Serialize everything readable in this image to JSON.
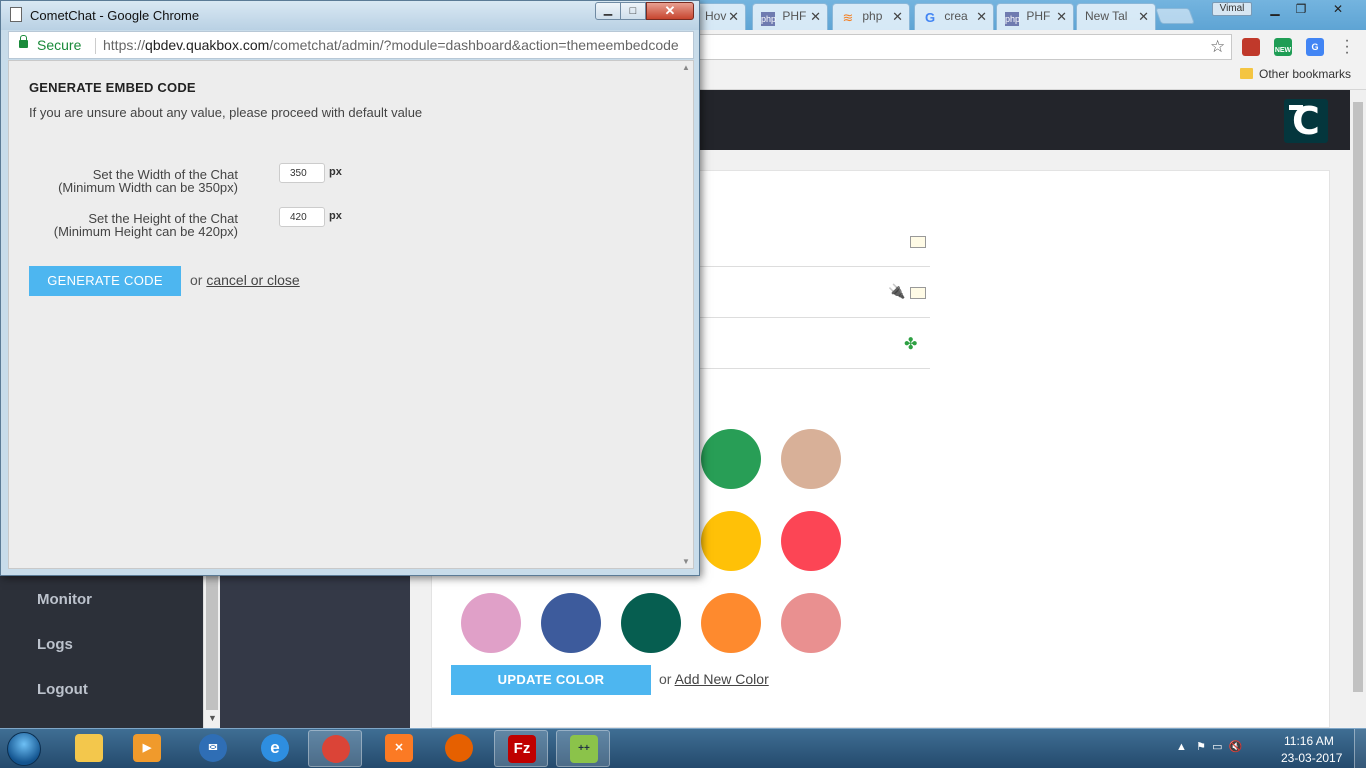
{
  "background_window": {
    "tabs": [
      {
        "label": "Hov",
        "favicon": "doc-icon"
      },
      {
        "label": "PHF",
        "favicon": "php-icon"
      },
      {
        "label": "php",
        "favicon": "stackoverflow-icon"
      },
      {
        "label": "crea",
        "favicon": "google-icon"
      },
      {
        "label": "PHF",
        "favicon": "php-icon"
      },
      {
        "label": "New Tal",
        "favicon": ""
      }
    ],
    "tab_close_glyph": "✕",
    "user_badge": "Vimal",
    "other_bookmarks": "Other bookmarks",
    "ext_new_badge": "NEW",
    "logo_letter": "C",
    "sidebar": [
      {
        "label": "Monitor"
      },
      {
        "label": "Logs"
      },
      {
        "label": "Logout"
      }
    ],
    "color_swatches": [
      "#289e56",
      "#d8b098",
      "#ffc107",
      "#fc4555",
      "#e0a0c8",
      "#3d5b9c",
      "#065e50",
      "#fe8a2e",
      "#e99090"
    ],
    "update_color_label": "UPDATE COLOR",
    "or_text": "or",
    "add_color_link": "Add New Color"
  },
  "popup": {
    "window_title": "CometChat - Google Chrome",
    "secure_label": "Secure",
    "url_scheme": "https://",
    "url_host": "qbdev.quakbox.com",
    "url_path": "/cometchat/admin/?module=dashboard&action=themeembedcode",
    "heading": "GENERATE EMBED CODE",
    "note": "If you are unsure about any value, please proceed with default value",
    "width_label": "Set the Width of the Chat",
    "width_hint": "(Minimum Width can be 350px)",
    "width_value": "350",
    "height_label": "Set the Height of the Chat",
    "height_hint": "(Minimum Height can be 420px)",
    "height_value": "420",
    "unit": "px",
    "generate_label": "GENERATE CODE",
    "or_text": "or",
    "cancel_link": "cancel or close"
  },
  "taskbar": {
    "apps": [
      {
        "name": "explorer-icon",
        "color": "#f3c74c"
      },
      {
        "name": "media-player-icon",
        "color": "#f09a2c"
      },
      {
        "name": "thunderbird-icon",
        "color": "#2f6eb5"
      },
      {
        "name": "internet-explorer-icon",
        "color": "#2e8ee0"
      },
      {
        "name": "chrome-icon",
        "color": "#db4437"
      },
      {
        "name": "xampp-icon",
        "color": "#fb7a24"
      },
      {
        "name": "firefox-icon",
        "color": "#e66000"
      },
      {
        "name": "filezilla-icon",
        "color": "#bf0000"
      },
      {
        "name": "notepad-plus-icon",
        "color": "#8bc34a"
      }
    ],
    "time": "11:16 AM",
    "date": "23-03-2017"
  }
}
